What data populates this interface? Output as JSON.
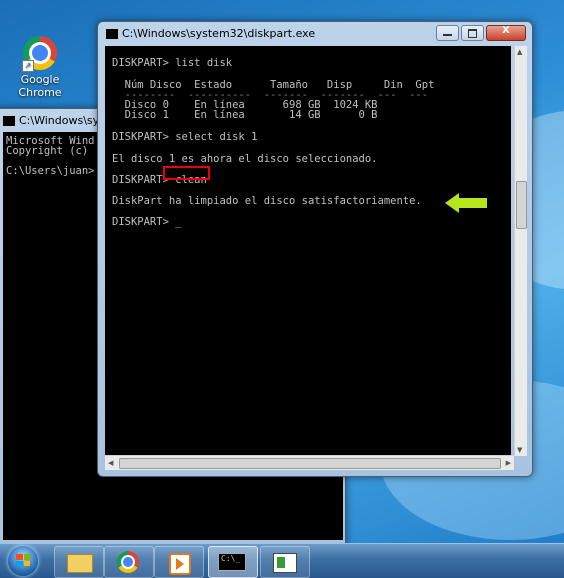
{
  "desktop": {
    "icons": [
      {
        "label": "Google Chrome",
        "icon": "chrome-icon"
      }
    ]
  },
  "back_window": {
    "title": "C:\\Windows\\system",
    "lines": [
      "Microsoft Wind",
      "Copyright (c)",
      "",
      "C:\\Users\\juan>"
    ]
  },
  "front_window": {
    "title": "C:\\Windows\\system32\\diskpart.exe",
    "controls": {
      "minimize": "minimize",
      "maximize": "maximize",
      "close": "X"
    },
    "console_lines": [
      "DISKPART> list disk",
      "",
      "  Núm Disco  Estado      Tamaño   Disp     Din  Gpt",
      "  --------  ----------  -------  -------  ---  ---",
      "  Disco 0    En línea      698 GB  1024 KB",
      "  Disco 1    En línea       14 GB      0 B",
      "",
      "DISKPART> select disk 1",
      "",
      "El disco 1 es ahora el disco seleccionado.",
      "",
      "DISKPART> clean",
      "",
      "DiskPart ha limpiado el disco satisfactoriamente.",
      "",
      "DISKPART> _"
    ],
    "highlight_text": "clean"
  },
  "annotations": {
    "arrow_color": "#b5e61d",
    "highlight_color": "#e00000"
  },
  "taskbar": {
    "items": [
      {
        "name": "start",
        "icon": "windows-logo-icon"
      },
      {
        "name": "explorer",
        "icon": "folder-icon"
      },
      {
        "name": "chrome",
        "icon": "chrome-icon"
      },
      {
        "name": "media-player",
        "icon": "media-player-icon"
      },
      {
        "name": "cmd",
        "icon": "cmd-icon",
        "active": true
      },
      {
        "name": "desktop-app",
        "icon": "desktop-app-icon"
      }
    ]
  }
}
